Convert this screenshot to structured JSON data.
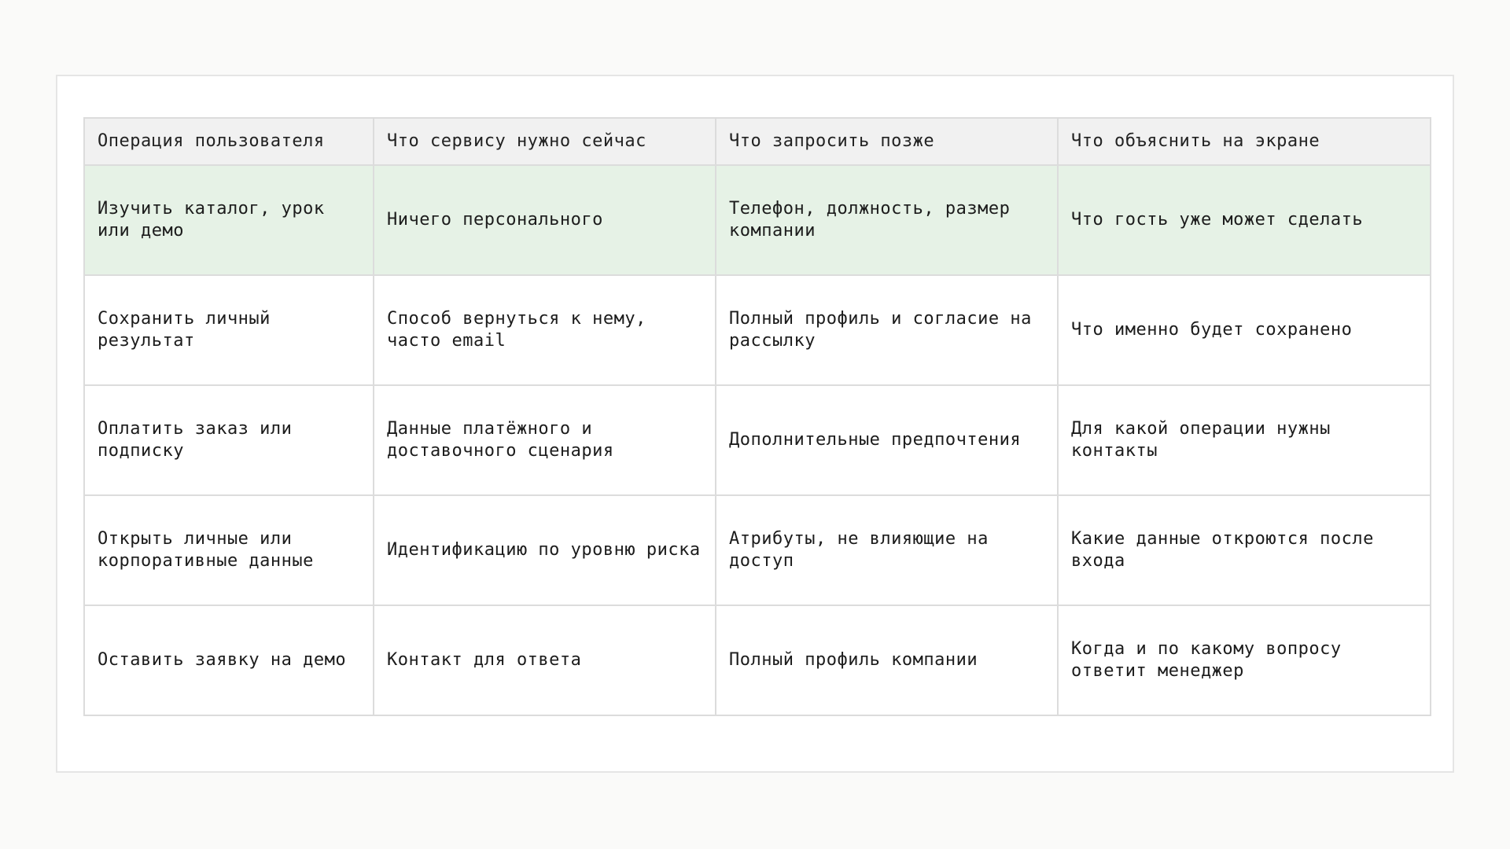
{
  "table": {
    "headers": [
      "Операция пользователя",
      "Что сервису нужно сейчас",
      "Что запросить позже",
      "Что объяснить на экране"
    ],
    "rows": [
      {
        "cells": [
          "Изучить каталог, урок или демо",
          "Ничего персонального",
          "Телефон, должность, размер компании",
          "Что гость уже может сделать"
        ],
        "highlighted": true
      },
      {
        "cells": [
          "Сохранить личный результат",
          "Способ вернуться к нему, часто email",
          "Полный профиль и согласие на рассылку",
          "Что именно будет сохранено"
        ],
        "highlighted": false
      },
      {
        "cells": [
          "Оплатить заказ или подписку",
          "Данные платёжного и доставочного сценария",
          "Дополнительные предпочтения",
          "Для какой операции нужны контакты"
        ],
        "highlighted": false
      },
      {
        "cells": [
          "Открыть личные или корпоративные данные",
          "Идентификацию по уровню риска",
          "Атрибуты, не влияющие на доступ",
          "Какие данные откроются после входа"
        ],
        "highlighted": false
      },
      {
        "cells": [
          "Оставить заявку на демо",
          "Контакт для ответа",
          "Полный профиль компании",
          "Когда и по какому вопросу ответит менеджер"
        ],
        "highlighted": false
      }
    ]
  },
  "colors": {
    "page_background": "#fafaf9",
    "card_background": "#ffffff",
    "header_background": "#f1f1f1",
    "highlight_row_background": "#e6f2e6",
    "grid_line": "#dcdcdc",
    "text": "#1c1c1c"
  }
}
